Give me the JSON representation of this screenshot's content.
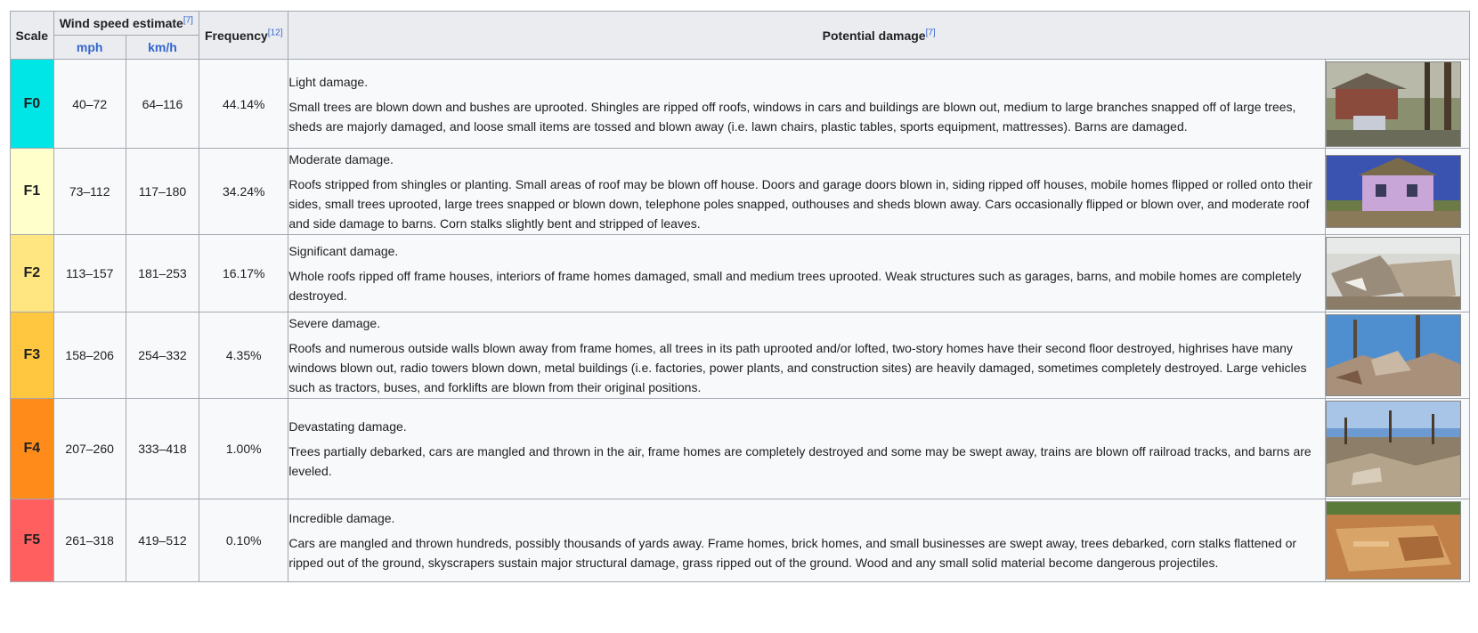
{
  "headers": {
    "scale": "Scale",
    "wind_speed": "Wind speed estimate",
    "wind_speed_ref": "[7]",
    "frequency": "Frequency",
    "frequency_ref": "[12]",
    "potential_damage": "Potential damage",
    "potential_damage_ref": "[7]",
    "mph": "mph",
    "kmh": "km/h"
  },
  "rows": [
    {
      "scale": "F0",
      "color": "#00e5e5",
      "mph": "40–72",
      "kmh": "64–116",
      "frequency": "44.14%",
      "level": "Light damage.",
      "description": "Small trees are blown down and bushes are uprooted. Shingles are ripped off roofs, windows in cars and buildings are blown out, medium to large branches snapped off of large trees, sheds are majorly damaged, and loose small items are tossed and blown away (i.e. lawn chairs, plastic tables, sports equipment, mattresses). Barns are damaged.",
      "image_icon": "damaged-house-photo"
    },
    {
      "scale": "F1",
      "color": "#ffffcc",
      "mph": "73–112",
      "kmh": "117–180",
      "frequency": "34.24%",
      "level": "Moderate damage.",
      "description": "Roofs stripped from shingles or planting. Small areas of roof may be blown off house. Doors and garage doors blown in, siding ripped off houses, mobile homes flipped or rolled onto their sides, small trees uprooted, large trees snapped or blown down, telephone poles snapped, outhouses and sheds blown away. Cars occasionally flipped or blown over, and moderate roof and side damage to barns. Corn stalks slightly bent and stripped of leaves.",
      "image_icon": "damaged-house-photo"
    },
    {
      "scale": "F2",
      "color": "#ffe680",
      "mph": "113–157",
      "kmh": "181–253",
      "frequency": "16.17%",
      "level": "Significant damage.",
      "description": "Whole roofs ripped off frame houses, interiors of frame homes damaged, small and medium trees uprooted. Weak structures such as garages, barns, and mobile homes are completely destroyed.",
      "image_icon": "debris-photo"
    },
    {
      "scale": "F3",
      "color": "#ffc640",
      "mph": "158–206",
      "kmh": "254–332",
      "frequency": "4.35%",
      "level": "Severe damage.",
      "description": "Roofs and numerous outside walls blown away from frame homes, all trees in its path uprooted and/or lofted, two-story homes have their second floor destroyed, highrises have many windows blown out, radio towers blown down, metal buildings (i.e. factories, power plants, and construction sites) are heavily damaged, sometimes completely destroyed. Large vehicles such as tractors, buses, and forklifts are blown from their original positions.",
      "image_icon": "debris-photo"
    },
    {
      "scale": "F4",
      "color": "#ff8c1a",
      "mph": "207–260",
      "kmh": "333–418",
      "frequency": "1.00%",
      "level": "Devastating damage.",
      "description": "Trees partially debarked, cars are mangled and thrown in the air, frame homes are completely destroyed and some may be swept away, trains are blown off railroad tracks, and barns are leveled.",
      "image_icon": "debris-field-photo"
    },
    {
      "scale": "F5",
      "color": "#ff5f5f",
      "mph": "261–318",
      "kmh": "419–512",
      "frequency": "0.10%",
      "level": "Incredible damage.",
      "description": "Cars are mangled and thrown hundreds, possibly thousands of yards away. Frame homes, brick homes, and small businesses are swept away, trees debarked, corn stalks flattened or ripped out of the ground, skyscrapers sustain major structural damage, grass ripped out of the ground. Wood and any small solid material become dangerous projectiles.",
      "image_icon": "foundation-photo"
    }
  ]
}
